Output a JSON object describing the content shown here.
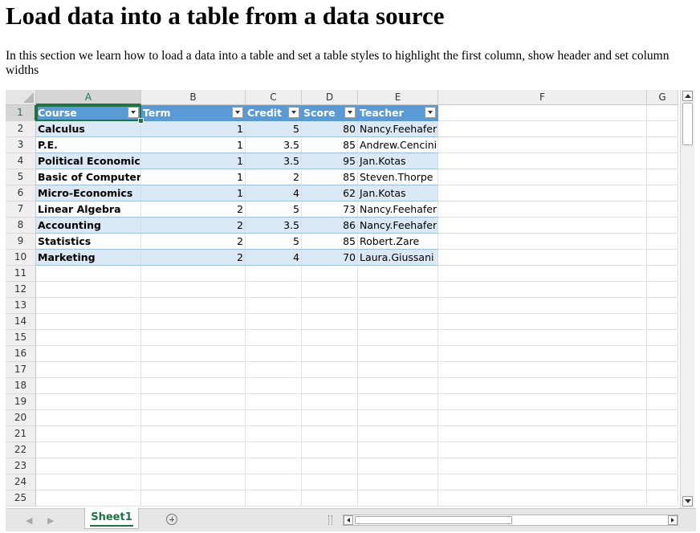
{
  "page": {
    "title": "Load data into a table from a data source",
    "intro": "In this section we learn how to load a data into a table and set a table styles to highlight the first column, show header and set column widths"
  },
  "spreadsheet": {
    "columns": [
      "A",
      "B",
      "C",
      "D",
      "E",
      "F",
      "G"
    ],
    "selected_column": "A",
    "selected_row": "1",
    "row_numbers": [
      "1",
      "2",
      "3",
      "4",
      "5",
      "6",
      "7",
      "8",
      "9",
      "10",
      "11",
      "12",
      "13",
      "14",
      "15",
      "16",
      "17",
      "18",
      "19",
      "20",
      "21",
      "22",
      "23",
      "24",
      "25"
    ],
    "table": {
      "headers": [
        "Course",
        "Term",
        "Credit",
        "Score",
        "Teacher"
      ],
      "rows": [
        [
          "Calculus",
          "1",
          "5",
          "80",
          "Nancy.Feehafer"
        ],
        [
          "P.E.",
          "1",
          "3.5",
          "85",
          "Andrew.Cencini"
        ],
        [
          "Political Economics",
          "1",
          "3.5",
          "95",
          "Jan.Kotas"
        ],
        [
          "Basic of Computer",
          "1",
          "2",
          "85",
          "Steven.Thorpe"
        ],
        [
          "Micro-Economics",
          "1",
          "4",
          "62",
          "Jan.Kotas"
        ],
        [
          "Linear Algebra",
          "2",
          "5",
          "73",
          "Nancy.Feehafer"
        ],
        [
          "Accounting",
          "2",
          "3.5",
          "86",
          "Nancy.Feehafer"
        ],
        [
          "Statistics",
          "2",
          "5",
          "85",
          "Robert.Zare"
        ],
        [
          "Marketing",
          "2",
          "4",
          "70",
          "Laura.Giussani"
        ]
      ]
    },
    "style": {
      "header_color": "#5b9bd5",
      "band_color": "#dbe8f5",
      "accent_color": "#217346"
    }
  },
  "sheet_tabs": {
    "active": "Sheet1",
    "add_icon": "plus-circle-icon"
  }
}
